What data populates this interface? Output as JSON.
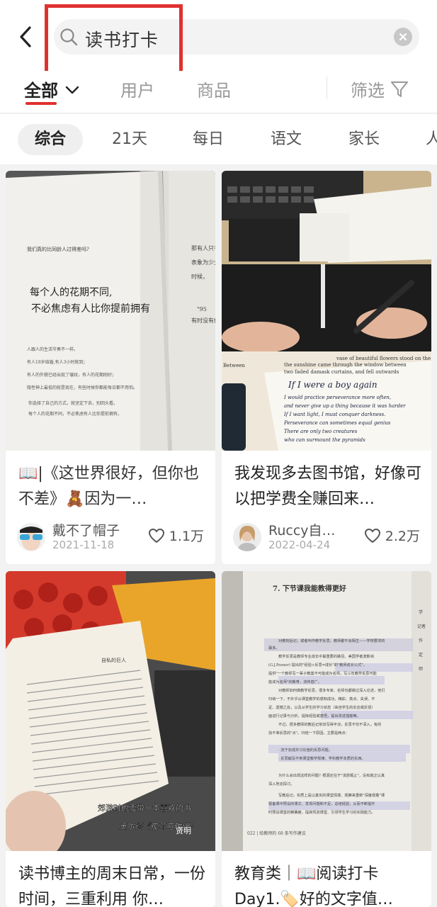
{
  "search": {
    "query": "读书打卡"
  },
  "main_tabs": [
    {
      "label": "全部",
      "active": true
    },
    {
      "label": "用户"
    },
    {
      "label": "商品"
    }
  ],
  "filter": {
    "label": "筛选"
  },
  "sub_tabs": [
    {
      "label": "综合",
      "active": true
    },
    {
      "label": "21天"
    },
    {
      "label": "每日"
    },
    {
      "label": "语文"
    },
    {
      "label": "家长"
    },
    {
      "label": "人"
    }
  ],
  "colors": {
    "accent": "#e0302f",
    "highlight_box": "#e0302f"
  },
  "cards": [
    {
      "title_prefix_icon": "open-book-emoji",
      "title": "📖|《这世界很好，但你也不差》🧸因为一…",
      "author": "戴不了帽子",
      "date": "2021-11-18",
      "likes": "1.1万",
      "image_text": {
        "small_heading": "我们真的比同龄人过得差吗?",
        "quote_line1": "每个人的花期不同,",
        "quote_line2": "不必焦虑有人比你提前拥有",
        "body_lines": [
          "人跟人的生活节奏不一样。",
          "有人18岁结婚,有人3小时就到；",
          "有人的外貌已经出现了皱纹，有人的花期刚好；",
          "隐性神上最低的就是现在，有些时候你都能每日都不用怕。"
        ],
        "footer_lines": [
          "你选择了自己的方式，就坚定下去，别回头看。",
          "每个人的花期不同，不必焦虑有人比你提前拥有。"
        ],
        "right_page_lines": [
          "那有人只有无",
          "表象为少女",
          "时候，",
          "\"95",
          "有时没有你说"
        ]
      }
    },
    {
      "title": "我发现多去图书馆，好像可以把学费全赚回来…",
      "author": "Ruccy自…",
      "date": "2022-04-24",
      "likes": "2.2万",
      "image_text": {
        "handwriting_title": "If I were a boy again",
        "handwriting_lines": [
          "If I were a boy again",
          "I would practice perseverance more often,",
          "and never give up a thing because it was harder",
          "If I want light, I must conquer darkness.",
          "Perseverance can sometimes equal genius",
          "There are only two creatures",
          "who can surmount the pyramids"
        ],
        "print_lines": [
          "vase of beautiful flowers stood on the centre of",
          "the sunshine came through the window between",
          "two faded damask curtains, and fell outwards",
          "Between"
        ]
      }
    },
    {
      "title": "读书博主的周末日常，一份时间，三重利用 你…",
      "image_text": {
        "running_head": "自私的巨人",
        "caption_line1": "郊游时也要带一本喜欢的书",
        "caption_line2": "王尔德《夜莺与玫瑰》",
        "corner_text": "贤明"
      }
    },
    {
      "title": "教育类｜📖阅读打卡 Day1.🏷️好的文字值…",
      "image_text": {
        "chapter_title": "7. 下节课我能教得更好",
        "page_footer": "022 | 给教师的 68 条写作建议",
        "body_lines": [
          "对教刻后记，或者叫作教学反思，教师都不会陌生——学校要求的",
          "最多。",
          "教学反思是教师专业成长中最重要的路径。美国学者波斯纳",
          "(G.J.Posner) 提出的\"经验+反思=成长\"的\"教师成长公式\"，",
          "提供\"一个教师写一辈子教案不可能成为名师，写三年教学反思可能",
          "能成为名师\"的教育，流传甚广。",
          "对教师如何做教学反思，很多专家、名师也都做过深入论述，他们",
          "归纳一下，不外乎从课堂教学的感知成功、精彩、亮点、失误、不",
          "足、遗憾之处，以及从学生的学习状态（来自学生的反应或反馈）",
          "面进行记录与分析，提炼经验或感悟，提出改进措施等。",
          "不过，很多教师的教后记依旧写得平淡，反思不仅不深入，有的",
          "找不准反思的\"点\"。归结一下原因，主要是两点：",
          "· 流于完成并讨论值的反思问题，",
          "· 反思触及不到课堂教学规律、学科教学本质的东西。",
          "为什么会出现这样的问题？根源还在于\"浅尝辄止\"，没有真正认真",
          "深入地去探讨。",
          "写教后记，实质上是以真实的课堂情境、观察来重新\"深度观看\"课",
          "视备课中预设的课文、发现问题和不足，总结经验，从而不断提升",
          "时预设课堂的精确度，提高驾驭课堂、引领学生学习的实践能力。"
        ],
        "right_strip": [
          "学",
          "记者",
          "作",
          "定",
          "师"
        ]
      }
    }
  ]
}
